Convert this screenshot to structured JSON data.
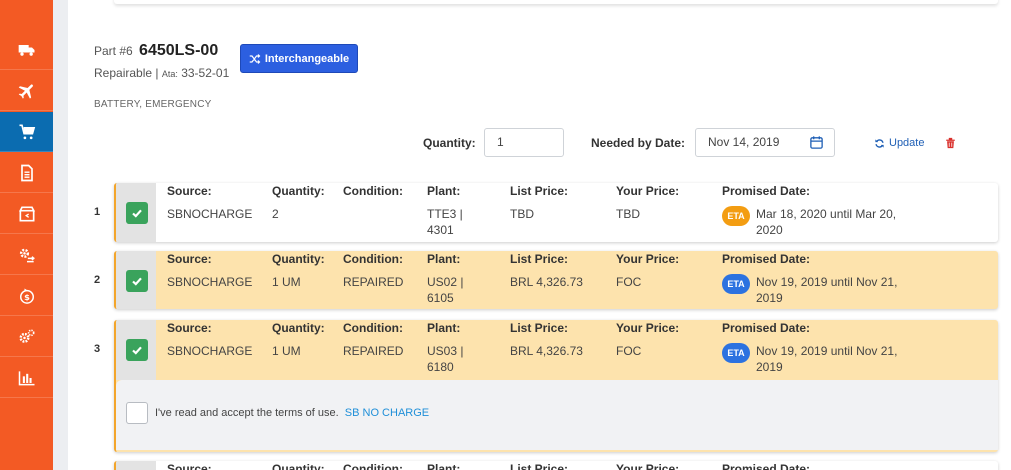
{
  "sidebar": {
    "items": [
      {
        "icon": "truck-icon"
      },
      {
        "icon": "plane-icon"
      },
      {
        "icon": "cart-icon",
        "active": true
      },
      {
        "icon": "document-icon"
      },
      {
        "icon": "box-icon"
      },
      {
        "icon": "exchange-gear-icon"
      },
      {
        "icon": "dollar-cycle-icon"
      },
      {
        "icon": "gears-icon"
      },
      {
        "icon": "bar-chart-icon"
      }
    ]
  },
  "part": {
    "prefix": "Part #6",
    "number": "6450LS-00",
    "condition": "Repairable |",
    "ata_label": "Ata:",
    "ata_value": "33-52-01",
    "description": "BATTERY, EMERGENCY",
    "interchange_label": "Interchangeable"
  },
  "order": {
    "quantity_label": "Quantity:",
    "quantity_value": "1",
    "date_label": "Needed by Date:",
    "date_value": "Nov 14, 2019",
    "update_label": "Update"
  },
  "columns": {
    "source": "Source:",
    "quantity": "Quantity:",
    "condition": "Condition:",
    "plant": "Plant:",
    "list_price": "List Price:",
    "your_price": "Your Price:",
    "promised_date": "Promised Date:"
  },
  "rows": [
    {
      "index": "1",
      "source": "SBNOCHARGE",
      "quantity": "2",
      "condition": "",
      "plant": "TTE3 | 4301",
      "list_price": "TBD",
      "your_price": "TBD",
      "eta": "ETA",
      "promised": "Mar 18, 2020 until Mar 20, 2020"
    },
    {
      "index": "2",
      "source": "SBNOCHARGE",
      "quantity": "1 UM",
      "condition": "REPAIRED",
      "plant": "US02 | 6105",
      "list_price": "BRL 4,326.73",
      "your_price": "FOC",
      "eta": "ETA",
      "promised": "Nov 19, 2019 until Nov 21, 2019"
    },
    {
      "index": "3",
      "source": "SBNOCHARGE",
      "quantity": "1 UM",
      "condition": "REPAIRED",
      "plant": "US03 | 6180",
      "list_price": "BRL 4,326.73",
      "your_price": "FOC",
      "eta": "ETA",
      "promised": "Nov 19, 2019 until Nov 21, 2019"
    },
    {
      "index": "",
      "source": "",
      "quantity": "",
      "condition": "",
      "plant": "",
      "list_price": "",
      "your_price": "",
      "eta": "",
      "promised": ""
    }
  ],
  "terms": {
    "text": "I've read and accept the terms of use.",
    "link": "SB NO CHARGE"
  },
  "colors": {
    "sidebar": "#f35a24",
    "sidebar_active": "#0b6cb0",
    "interchange_button": "#2c5fe0",
    "row_highlight": "#fde3ad",
    "row_border": "#f3a52b",
    "check_green": "#3aa35c",
    "eta_orange": "#f39d12",
    "eta_blue": "#2c72e0",
    "link_blue": "#1f8fd8"
  }
}
